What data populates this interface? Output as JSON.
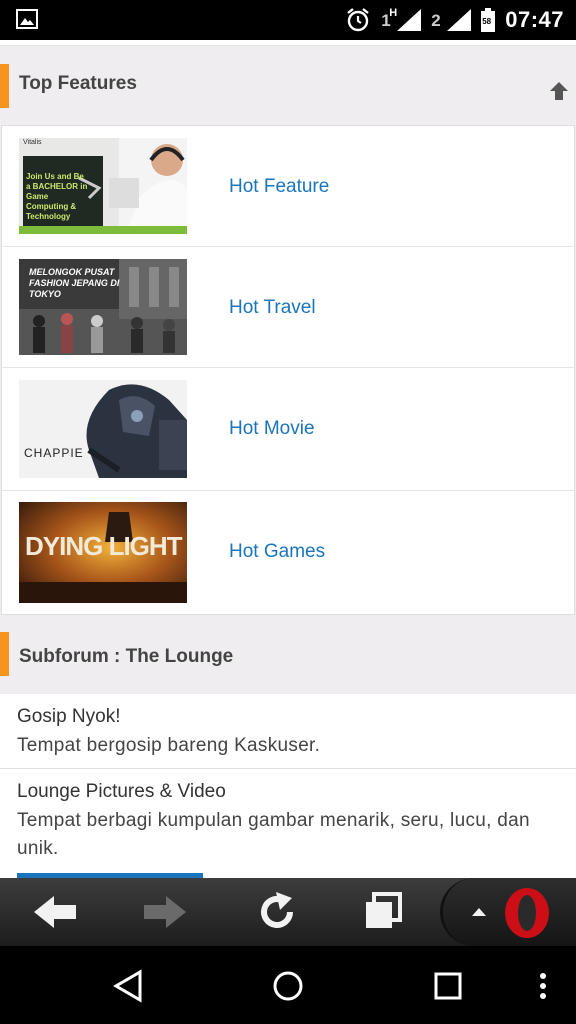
{
  "status_bar": {
    "time": "07:47",
    "sim1_label": "1",
    "sim1_network": "H",
    "sim2_label": "2",
    "battery_level": "58",
    "icons": [
      "image-notification-icon",
      "alarm-icon",
      "signal-sim1-icon",
      "signal-sim2-icon",
      "battery-icon"
    ]
  },
  "top_features": {
    "title": "Top  Features",
    "items": [
      {
        "label": "Hot Feature",
        "thumb_caption": "Join Us and Be a BACHELOR in Game Computing & Technology",
        "thumb_brand": "Vitalis"
      },
      {
        "label": "Hot Travel",
        "thumb_caption": "MELONGOK PUSAT FASHION JEPANG DI TOKYO"
      },
      {
        "label": "Hot Movie",
        "thumb_caption": "CHAPPIE"
      },
      {
        "label": "Hot Games",
        "thumb_caption": "DYING LIGHT"
      }
    ]
  },
  "subforum": {
    "title": "Subforum : The Lounge",
    "items": [
      {
        "title": "Gosip Nyok!",
        "desc": "Tempat  bergosip bareng Kaskuser."
      },
      {
        "title": "Lounge Pictures & Video",
        "desc": "Tempat  berbagi kumpulan gambar menarik, seru, lucu,  dan unik."
      }
    ]
  },
  "colors": {
    "accent_orange": "#f7941d",
    "link_blue": "#1b75bb",
    "opera_red": "#cc0f16"
  }
}
